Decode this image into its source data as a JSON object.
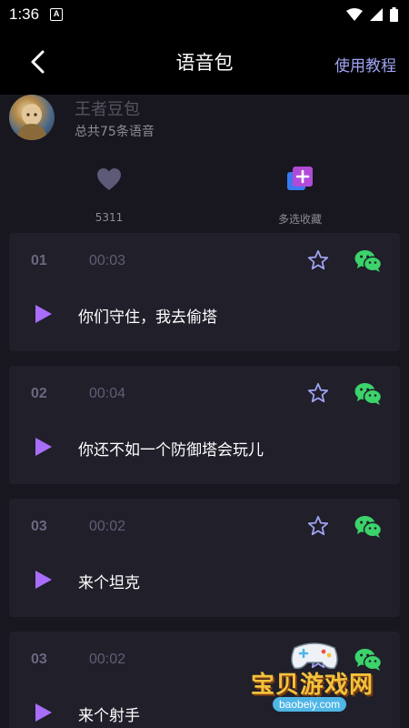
{
  "status": {
    "time": "1:36",
    "notification_letter": "A"
  },
  "header": {
    "title": "语音包",
    "tutorial": "使用教程"
  },
  "profile": {
    "name": "王者豆包",
    "count": "总共75条语音"
  },
  "actions": {
    "like_count": "5311",
    "multi_select": "多选收藏"
  },
  "colors": {
    "accent": "#9fa3f2",
    "play": "#a86dfa",
    "wechat": "#3bd36a",
    "background": "#18171f",
    "card": "#201f2a"
  },
  "voices": [
    {
      "index": "01",
      "duration": "00:03",
      "text": "你们守住，我去偷塔"
    },
    {
      "index": "02",
      "duration": "00:04",
      "text": "你还不如一个防御塔会玩儿"
    },
    {
      "index": "03",
      "duration": "00:02",
      "text": "来个坦克"
    },
    {
      "index": "03",
      "duration": "00:02",
      "text": "来个射手"
    }
  ],
  "watermark": {
    "text": "宝贝游戏网",
    "url": "baobeiy.com"
  }
}
